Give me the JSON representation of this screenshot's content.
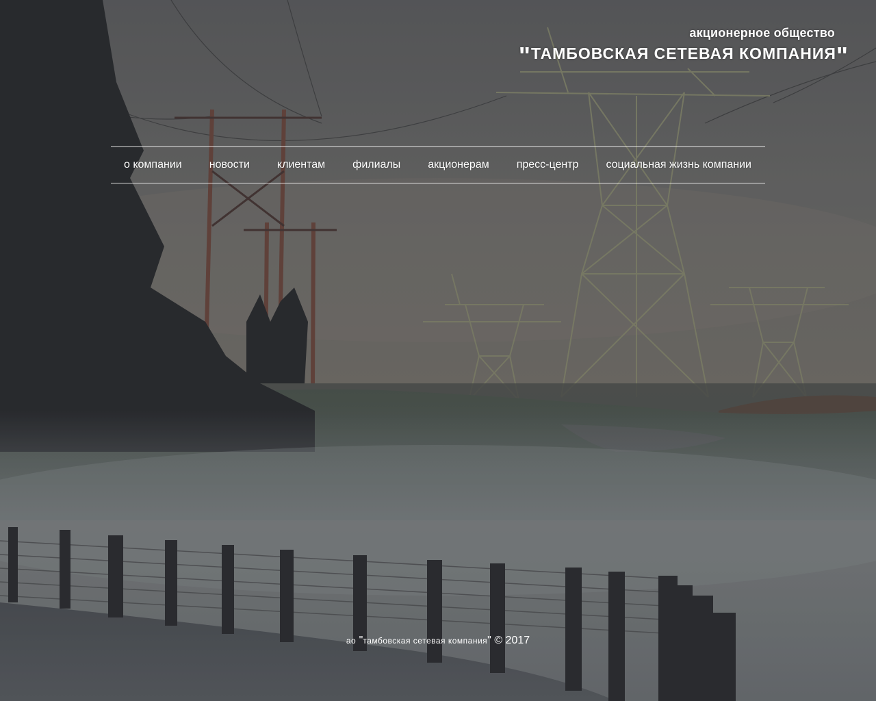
{
  "header": {
    "org_type": "акционерное общество",
    "org_name": "тамбовская сетевая компания",
    "quote_open": "\"",
    "quote_close": "\""
  },
  "nav": {
    "items": [
      {
        "label": "о компании"
      },
      {
        "label": "новости"
      },
      {
        "label": "клиентам"
      },
      {
        "label": "филиалы"
      },
      {
        "label": "акционерам"
      },
      {
        "label": "пресс-центр"
      },
      {
        "label": "социальная жизнь компании"
      }
    ]
  },
  "footer": {
    "prefix": "ао",
    "quote_open": "\"",
    "company": "тамбовская сетевая компания",
    "quote_close": "\"",
    "copyright": "© 2017"
  },
  "background": {
    "description_icon": "power-lines-fog-photo",
    "sky_color": "#6f6f6c",
    "fog_color": "#7a7f80",
    "tree_color": "#2f3134"
  }
}
